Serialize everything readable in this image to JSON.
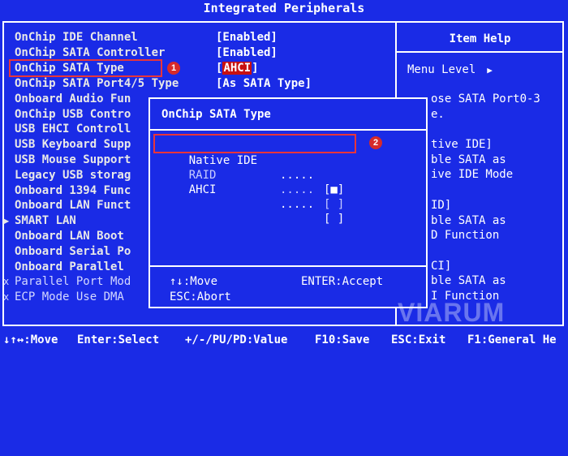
{
  "header": {
    "title": "Integrated Peripherals"
  },
  "help": {
    "title": "Item Help",
    "menu_level": "Menu Level",
    "lines": [
      "ose SATA Port0-3",
      "e.",
      "",
      "tive IDE]",
      "ble SATA as",
      "ive IDE Mode",
      "",
      "ID]",
      "ble SATA as",
      "D Function",
      "",
      "CI]",
      "ble SATA as",
      "I Function"
    ]
  },
  "items": [
    {
      "label": "OnChip IDE Channel",
      "value": "[Enabled]"
    },
    {
      "label": "OnChip SATA Controller",
      "value": "[Enabled]"
    },
    {
      "label": "OnChip SATA Type",
      "value": "AHCI"
    },
    {
      "label": "OnChip SATA Port4/5 Type",
      "value": "[As SATA Type]"
    },
    {
      "label": "Onboard Audio Fun",
      "value": ""
    },
    {
      "label": "OnChip USB Contro",
      "value": ""
    },
    {
      "label": "USB EHCI Controll",
      "value": ""
    },
    {
      "label": "USB Keyboard Supp",
      "value": ""
    },
    {
      "label": "USB Mouse Support",
      "value": ""
    },
    {
      "label": "Legacy USB storag",
      "value": ""
    },
    {
      "label": "Onboard 1394 Func",
      "value": ""
    },
    {
      "label": "Onboard LAN Funct",
      "value": ""
    },
    {
      "label": "SMART LAN",
      "value": ""
    },
    {
      "label": "Onboard LAN Boot",
      "value": ""
    },
    {
      "label": "Onboard Serial Po",
      "value": ""
    },
    {
      "label": "Onboard Parallel",
      "value": ""
    },
    {
      "label": "Parallel Port Mod",
      "value": ""
    },
    {
      "label": "ECP Mode Use DMA",
      "value": ""
    }
  ],
  "popup": {
    "title": "OnChip SATA Type",
    "options": [
      {
        "label": "Native IDE",
        "dots": ".....",
        "mark": "[■]"
      },
      {
        "label": "RAID",
        "dots": ".....",
        "mark": "[ ]"
      },
      {
        "label": "AHCI",
        "dots": ".....",
        "mark": "[ ]"
      }
    ],
    "hint_move": "↑↓:Move",
    "hint_enter": "ENTER:Accept",
    "hint_esc": "ESC:Abort"
  },
  "annotations": {
    "badge1": "1",
    "badge2": "2"
  },
  "statusbar": {
    "move": "↓↑↔:Move",
    "enter": "Enter:Select",
    "value": "+/-/PU/PD:Value",
    "save": "F10:Save",
    "exit": "ESC:Exit",
    "help": "F1:General He"
  },
  "watermark": "VIARUM",
  "colors": {
    "background": "#1a2be6",
    "highlight": "#c81010",
    "annotation": "#e8353a"
  }
}
